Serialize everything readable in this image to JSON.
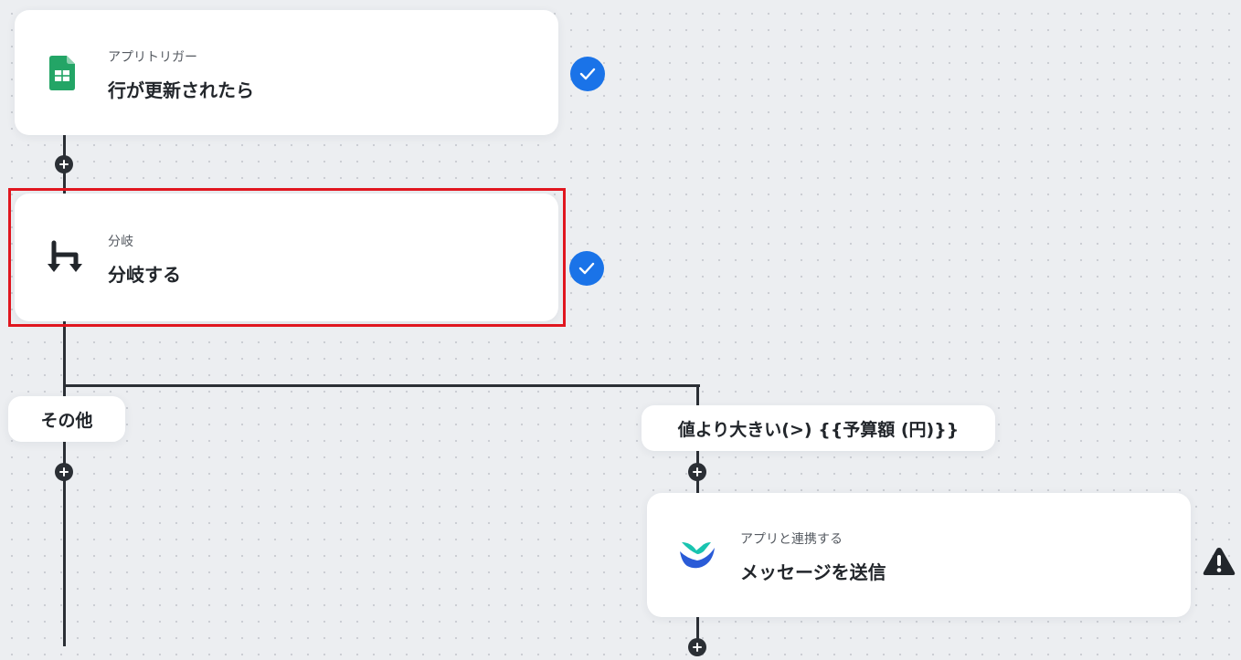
{
  "nodes": [
    {
      "sub": "アプリトリガー",
      "title": "行が更新されたら",
      "icon": "google-sheets-icon",
      "status": "check-icon"
    },
    {
      "sub": "分岐",
      "title": "分岐する",
      "icon": "branch-icon",
      "status": "check-icon"
    },
    {
      "sub": "アプリと連携する",
      "title": "メッセージを送信",
      "icon": "chatwork-app-icon",
      "status": "warning-icon"
    }
  ],
  "branches": {
    "else_label": "その他",
    "condition_label": "値より大きい(>) {{予算額 (円)}}"
  },
  "colors": {
    "check": "#1a73e8",
    "highlight": "#e0161f",
    "line": "#2b2f35",
    "sheets_green": "#23a566",
    "app_blue": "#2a5bd7",
    "app_teal": "#19c4b0"
  }
}
